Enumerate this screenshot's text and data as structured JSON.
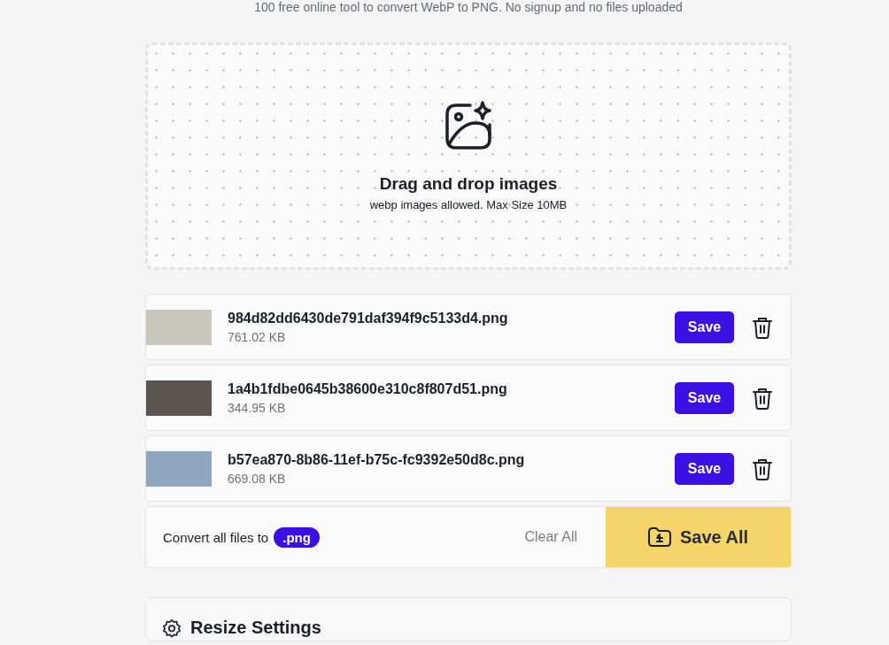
{
  "tagline": "100 free online tool to convert WebP to PNG. No signup and no files uploaded",
  "dropzone": {
    "title": "Drag and drop images",
    "hint": "webp images allowed. Max Size 10MB"
  },
  "files": [
    {
      "name": "984d82dd6430de791daf394f9c5133d4.png",
      "size": "761.02 KB",
      "save": "Save"
    },
    {
      "name": "1a4b1fdbe0645b38600e310c8f807d51.png",
      "size": "344.95 KB",
      "save": "Save"
    },
    {
      "name": "b57ea870-8b86-11ef-b75c-fc9392e50d8c.png",
      "size": "669.08 KB",
      "save": "Save"
    }
  ],
  "convert_bar": {
    "label": "Convert all files to",
    "format": ".png",
    "clear": "Clear All",
    "save_all": "Save All"
  },
  "resize_settings": {
    "title": "Resize Settings"
  }
}
